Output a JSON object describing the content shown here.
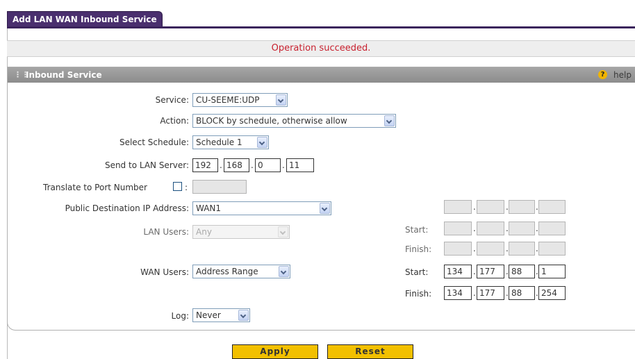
{
  "tab": {
    "title": "Add LAN WAN Inbound Service"
  },
  "status": {
    "message": "Operation succeeded."
  },
  "panel": {
    "title": "Inbound Service",
    "help_label": "help",
    "help_symbol": "?"
  },
  "form": {
    "service": {
      "label": "Service:",
      "value": "CU-SEEME:UDP"
    },
    "action": {
      "label": "Action:",
      "value": "BLOCK by schedule, otherwise allow"
    },
    "schedule": {
      "label": "Select Schedule:",
      "value": "Schedule 1"
    },
    "lan_server": {
      "label": "Send to LAN Server:",
      "octets": [
        "192",
        "168",
        "0",
        "11"
      ]
    },
    "translate_port": {
      "label": "Translate to Port Number",
      "colon": ":",
      "checked": false,
      "value": ""
    },
    "public_dest": {
      "label": "Public Destination IP Address:",
      "value": "WAN1",
      "octets": [
        "",
        "",
        "",
        ""
      ]
    },
    "lan_users": {
      "label": "LAN Users:",
      "value": "Any",
      "start_label": "Start:",
      "finish_label": "Finish:",
      "start_octets": [
        "",
        "",
        "",
        ""
      ],
      "finish_octets": [
        "",
        "",
        "",
        ""
      ]
    },
    "wan_users": {
      "label": "WAN Users:",
      "value": "Address Range",
      "start_label": "Start:",
      "finish_label": "Finish:",
      "start_octets": [
        "134",
        "177",
        "88",
        "1"
      ],
      "finish_octets": [
        "134",
        "177",
        "88",
        "254"
      ]
    },
    "log": {
      "label": "Log:",
      "value": "Never"
    }
  },
  "buttons": {
    "apply": "Apply",
    "reset": "Reset"
  },
  "colors": {
    "tab": "#4a2f6e",
    "status_text": "#c8212f",
    "panel_header": "#999999",
    "button": "#f2c000"
  }
}
